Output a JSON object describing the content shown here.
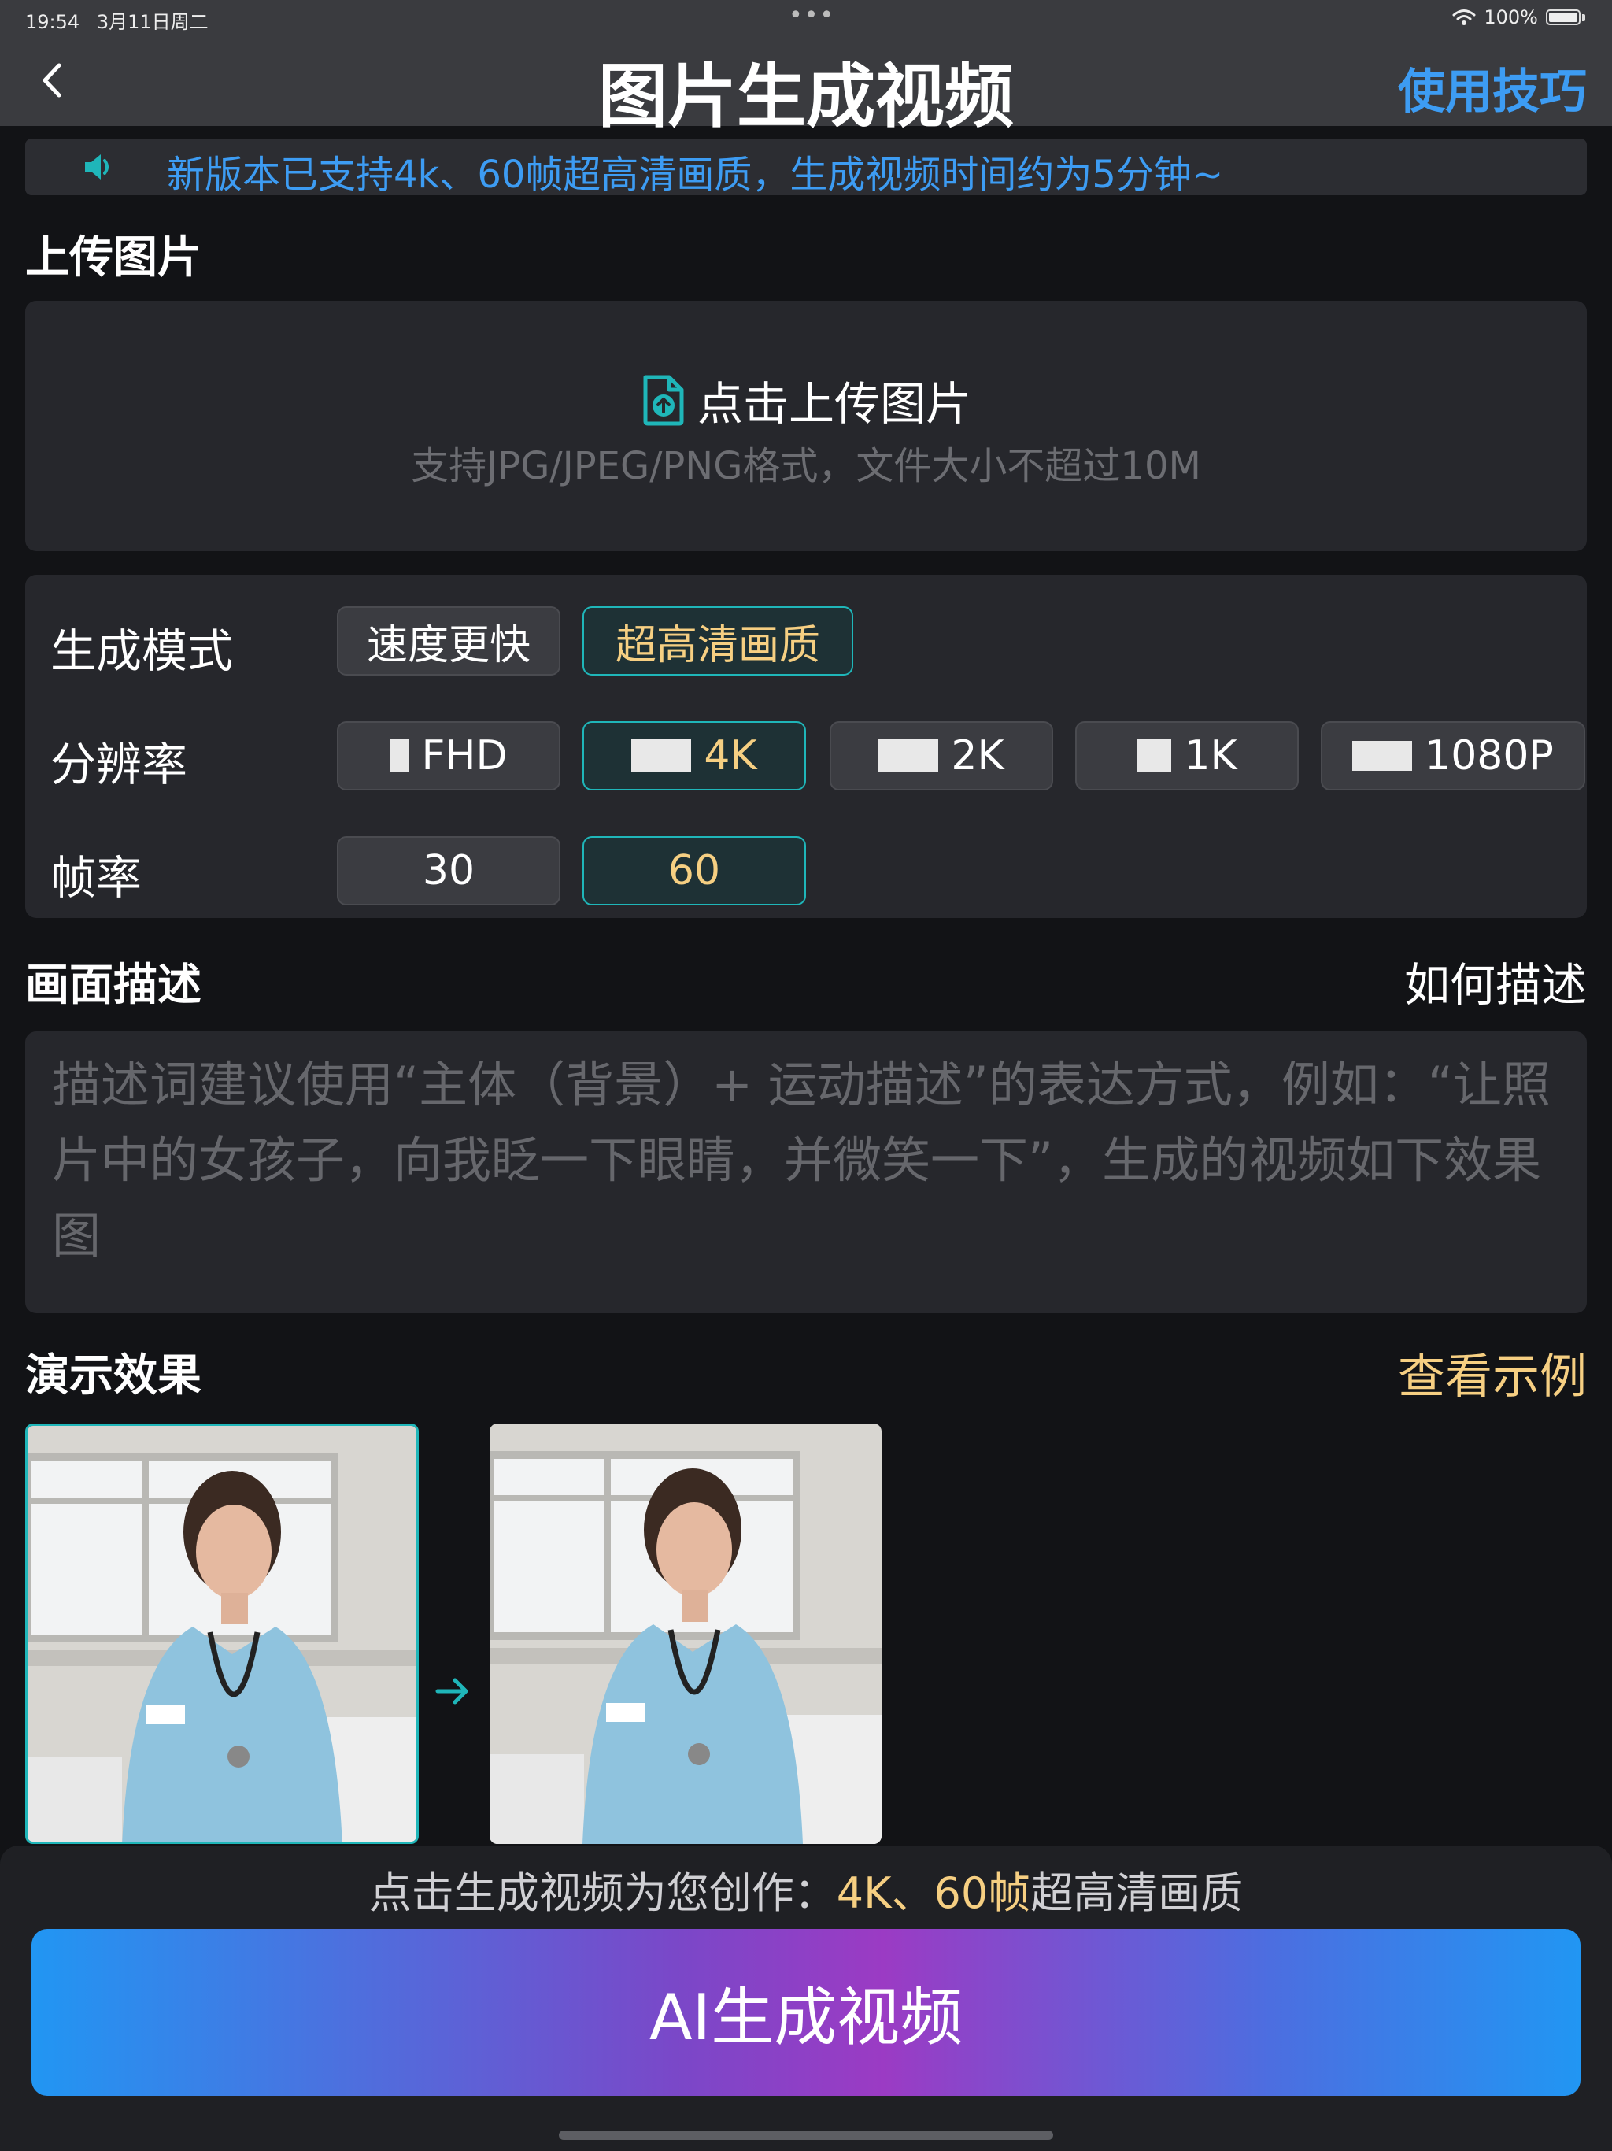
{
  "status": {
    "time": "19:54",
    "date": "3月11日周二",
    "battery": "100%"
  },
  "nav": {
    "title": "图片生成视频",
    "tips": "使用技巧"
  },
  "notice": {
    "text": "新版本已支持4k、60帧超高清画质，生成视频时间约为5分钟~"
  },
  "upload": {
    "section_title": "上传图片",
    "label": "点击上传图片",
    "hint": "支持JPG/JPEG/PNG格式，文件大小不超过10M"
  },
  "options": {
    "mode": {
      "label": "生成模式",
      "choices": [
        "速度更快",
        "超高清画质"
      ],
      "selected": "超高清画质"
    },
    "resolution": {
      "label": "分辨率",
      "choices": [
        "FHD",
        "4K",
        "2K",
        "1K",
        "1080P"
      ],
      "selected": "4K"
    },
    "framerate": {
      "label": "帧率",
      "choices": [
        "30",
        "60"
      ],
      "selected": "60"
    }
  },
  "description": {
    "section_title": "画面描述",
    "help_link": "如何描述",
    "placeholder": "描述词建议使用“主体（背景）+ 运动描述”的表达方式，例如：“让照片中的女孩子，向我眨一下眼睛，并微笑一下”，生成的视频如下效果图"
  },
  "demo": {
    "section_title": "演示效果",
    "example_link": "查看示例"
  },
  "bottom": {
    "summary_prefix": "点击生成视频为您创作：",
    "summary_highlight": "4K、60帧",
    "summary_suffix": "超高清画质",
    "button_label": "AI生成视频"
  },
  "colors": {
    "accent_blue": "#3d9cf3",
    "accent_teal": "#1fb6b9",
    "highlight_gold": "#f6cf82",
    "background": "#121316",
    "panel": "#26272c"
  }
}
